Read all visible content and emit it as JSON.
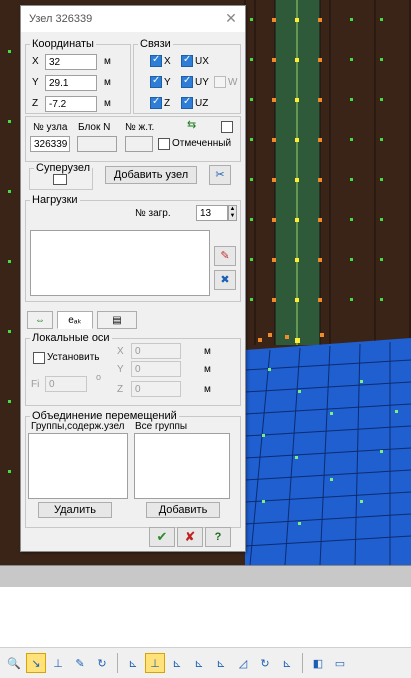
{
  "dialog": {
    "title": "Узел 326339",
    "coords_group": "Координаты",
    "links_group": "Связи",
    "x_label": "X",
    "x_value": "32",
    "x_unit": "м",
    "y_label": "Y",
    "y_value": "29.1",
    "y_unit": "м",
    "z_label": "Z",
    "z_value": "-7.2",
    "z_unit": "м",
    "links": {
      "x": "X",
      "y": "Y",
      "z": "Z",
      "ux": "UX",
      "uy": "UY",
      "uz": "UZ",
      "w": "W"
    },
    "node_no_label": "№ узла",
    "node_no": "326339",
    "block_label": "Блок N",
    "stiff_label": "№ ж.т.",
    "marked_label": "Отмеченный",
    "superuzel_label": "Суперузел",
    "add_node_label": "Добавить узел",
    "loads_group": "Нагрузки",
    "load_no_label": "№ загр.",
    "load_no": "13",
    "tab_ak_label": "eₐₖ",
    "local_axes_group": "Локальные оси",
    "set_label": "Установить",
    "lx_label": "X",
    "lx_value": "0",
    "lx_unit": "м",
    "ly_label": "Y",
    "ly_value": "0",
    "ly_unit": "м",
    "lz_label": "Z",
    "lz_value": "0",
    "lz_unit": "м",
    "fi_label": "Fi",
    "fi_value": "0",
    "fi_unit": "о",
    "merge_group": "Объединение перемещений",
    "groups_with_node": "Группы,содерж.узел",
    "all_groups": "Все группы",
    "delete_label": "Удалить",
    "add_label": "Добавить",
    "ok_icon": "✔",
    "cancel_icon": "✘",
    "help_icon": "?"
  },
  "colors": {
    "accent": "#2e7dd6",
    "slab": "#1f5fd0",
    "column": "#2e5a3a",
    "background": "#3a2418"
  }
}
